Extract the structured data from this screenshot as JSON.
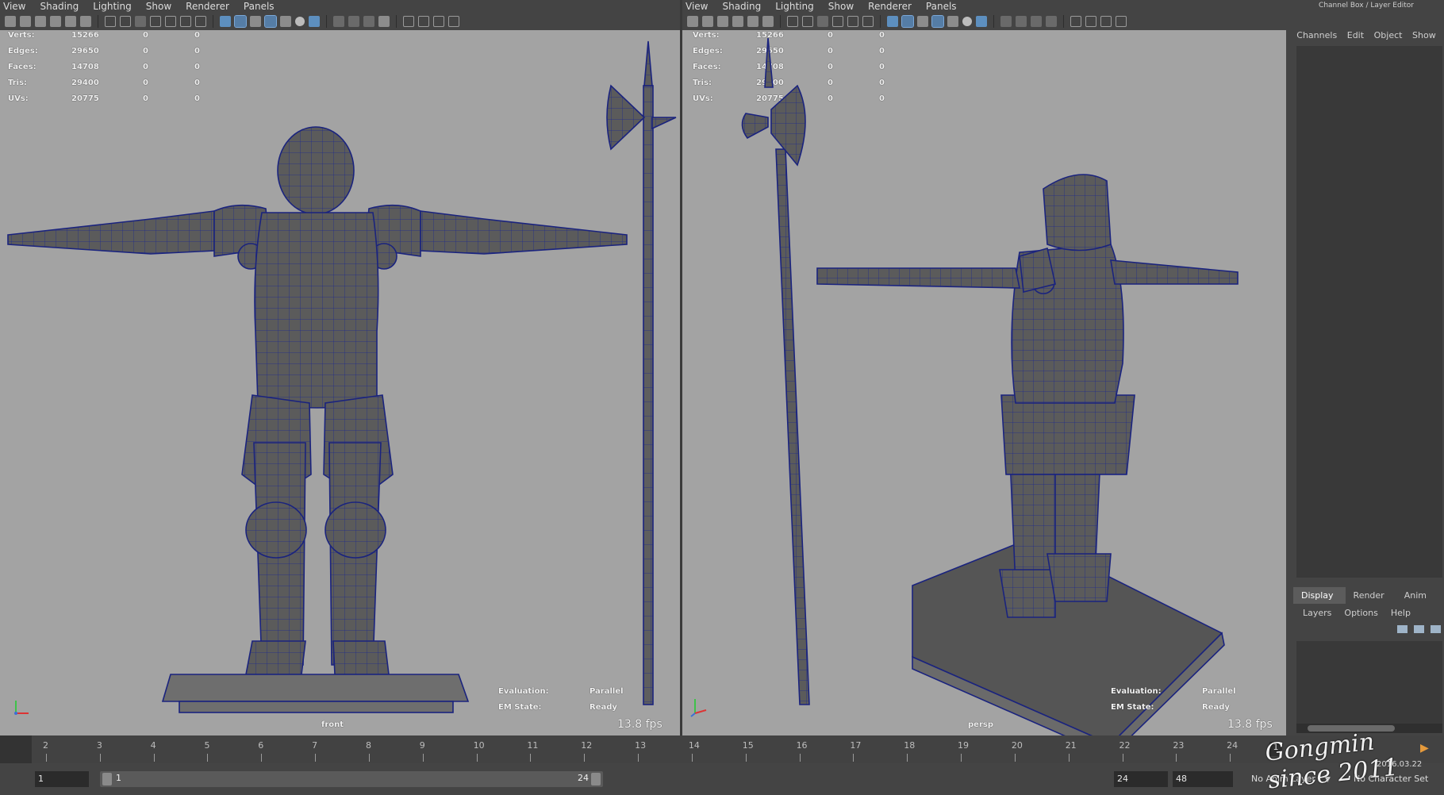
{
  "menus": [
    "View",
    "Shading",
    "Lighting",
    "Show",
    "Renderer",
    "Panels"
  ],
  "stats": [
    {
      "label": "Verts:",
      "value": "15266",
      "a": "0",
      "b": "0"
    },
    {
      "label": "Edges:",
      "value": "29650",
      "a": "0",
      "b": "0"
    },
    {
      "label": "Faces:",
      "value": "14708",
      "a": "0",
      "b": "0"
    },
    {
      "label": "Tris:",
      "value": "29400",
      "a": "0",
      "b": "0"
    },
    {
      "label": "UVs:",
      "value": "20775",
      "a": "0",
      "b": "0"
    }
  ],
  "viewport_left": {
    "camera": "front",
    "evaluation_label": "Evaluation:",
    "evaluation_value": "Parallel",
    "em_label": "EM State:",
    "em_value": "Ready",
    "fps": "13.8 fps"
  },
  "viewport_right": {
    "camera": "persp",
    "evaluation_label": "Evaluation:",
    "evaluation_value": "Parallel",
    "em_label": "EM State:",
    "em_value": "Ready",
    "fps": "13.8 fps"
  },
  "channel_box": {
    "title": "Channel Box / Layer Editor",
    "menu": [
      "Channels",
      "Edit",
      "Object",
      "Show"
    ],
    "tabs": [
      "Display",
      "Render",
      "Anim"
    ],
    "active_tab": "Display",
    "layer_menu": [
      "Layers",
      "Options",
      "Help"
    ]
  },
  "timeline": {
    "ticks": [
      "2",
      "3",
      "4",
      "5",
      "6",
      "7",
      "8",
      "9",
      "10",
      "11",
      "12",
      "13",
      "14",
      "15",
      "16",
      "17",
      "18",
      "19",
      "20",
      "21",
      "22",
      "23",
      "24"
    ],
    "current_frame": "1"
  },
  "range": {
    "start_field": "1",
    "range_start": "1",
    "range_end": "24",
    "end_field": "24",
    "anim_end_field": "48",
    "anim_layer": "No Anim Layer",
    "character_set": "No Character Set"
  },
  "watermark": {
    "signature": "Gongmin since 2011",
    "date": "2016.03.22"
  },
  "colors": {
    "viewport_bg": "#a3a3a3",
    "mesh_fill": "#5b5b5b",
    "wire": "#1e2a8c",
    "ui_bg": "#444444",
    "playhead": "#e59a3c"
  }
}
